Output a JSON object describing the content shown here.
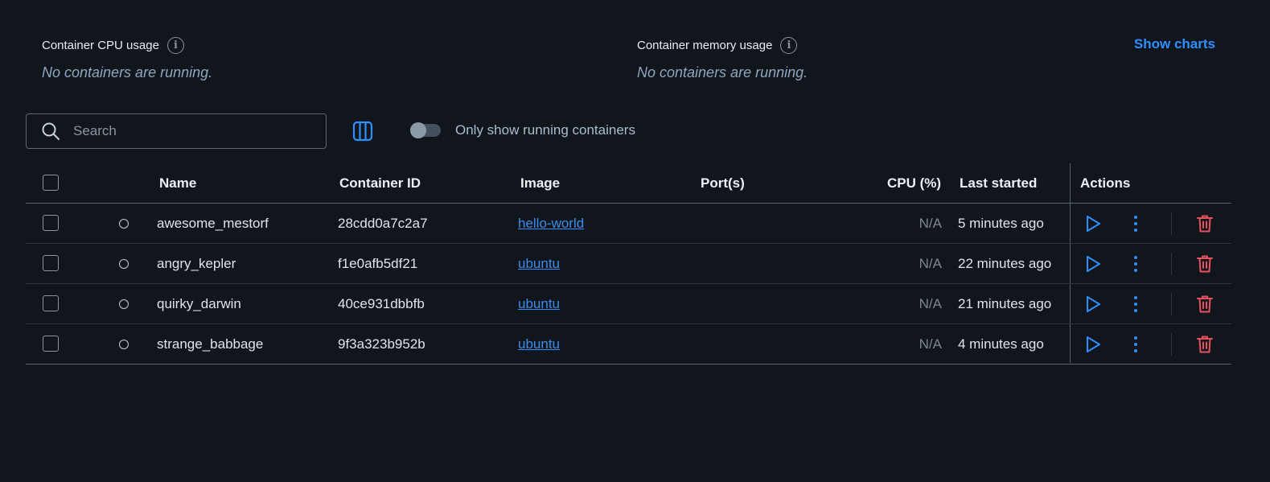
{
  "stats": {
    "cpu": {
      "title": "Container CPU usage",
      "subtitle": "No containers are running."
    },
    "memory": {
      "title": "Container memory usage",
      "subtitle": "No containers are running."
    },
    "show_charts": "Show charts"
  },
  "toolbar": {
    "search_placeholder": "Search",
    "search_value": "",
    "toggle_label": "Only show running containers",
    "toggle_on": false
  },
  "table": {
    "headers": {
      "name": "Name",
      "container_id": "Container ID",
      "image": "Image",
      "ports": "Port(s)",
      "cpu": "CPU (%)",
      "last_started": "Last started",
      "actions": "Actions"
    },
    "rows": [
      {
        "name": "awesome_mestorf",
        "container_id": "28cdd0a7c2a7",
        "image": "hello-world",
        "ports": "",
        "cpu": "N/A",
        "last_started": "5 minutes ago"
      },
      {
        "name": "angry_kepler",
        "container_id": "f1e0afb5df21",
        "image": "ubuntu",
        "ports": "",
        "cpu": "N/A",
        "last_started": "22 minutes ago"
      },
      {
        "name": "quirky_darwin",
        "container_id": "40ce931dbbfb",
        "image": "ubuntu",
        "ports": "",
        "cpu": "N/A",
        "last_started": "21 minutes ago"
      },
      {
        "name": "strange_babbage",
        "container_id": "9f3a323b952b",
        "image": "ubuntu",
        "ports": "",
        "cpu": "N/A",
        "last_started": "4 minutes ago"
      }
    ]
  },
  "colors": {
    "background": "#11151c",
    "accent": "#2f8fff",
    "link": "#3b8cf0",
    "delete": "#e8525f",
    "muted_text": "#8fa6bf"
  },
  "icons": {
    "info": "info-icon",
    "search": "search-icon",
    "columns": "columns-icon",
    "start": "play-icon",
    "more": "more-vertical-icon",
    "delete": "trash-icon"
  }
}
